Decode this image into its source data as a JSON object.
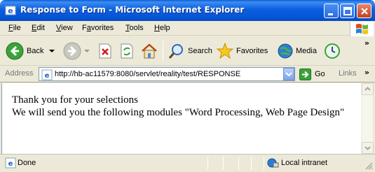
{
  "window": {
    "title": "Response to Form - Microsoft Internet Explorer"
  },
  "menu": {
    "items": [
      {
        "first": "F",
        "rest": "ile"
      },
      {
        "first": "E",
        "rest": "dit"
      },
      {
        "first": "V",
        "rest": "iew"
      },
      {
        "first": "",
        "mid_pre": "F",
        "underline": "a",
        "rest": "vorites"
      },
      {
        "first": "T",
        "rest": "ools"
      },
      {
        "first": "H",
        "rest": "elp"
      }
    ]
  },
  "toolbar": {
    "back_label": "Back",
    "search_label": "Search",
    "favorites_label": "Favorites",
    "media_label": "Media",
    "overflow": "»"
  },
  "address": {
    "label": "Address",
    "url": "http://hb-ac11579:8080/servlet/reality/test/RESPONSE",
    "go_label": "Go",
    "links_label": "Links",
    "overflow": "»"
  },
  "content": {
    "line1": "Thank you for your selections",
    "line2": "We will send you the following modules \"Word Processing, Web Page Design\""
  },
  "status": {
    "text": "Done",
    "zone": "Local intranet"
  },
  "colors": {
    "titlebar": "#0b5fe0",
    "chrome": "#ece9d8",
    "close_button": "#c3401e"
  }
}
